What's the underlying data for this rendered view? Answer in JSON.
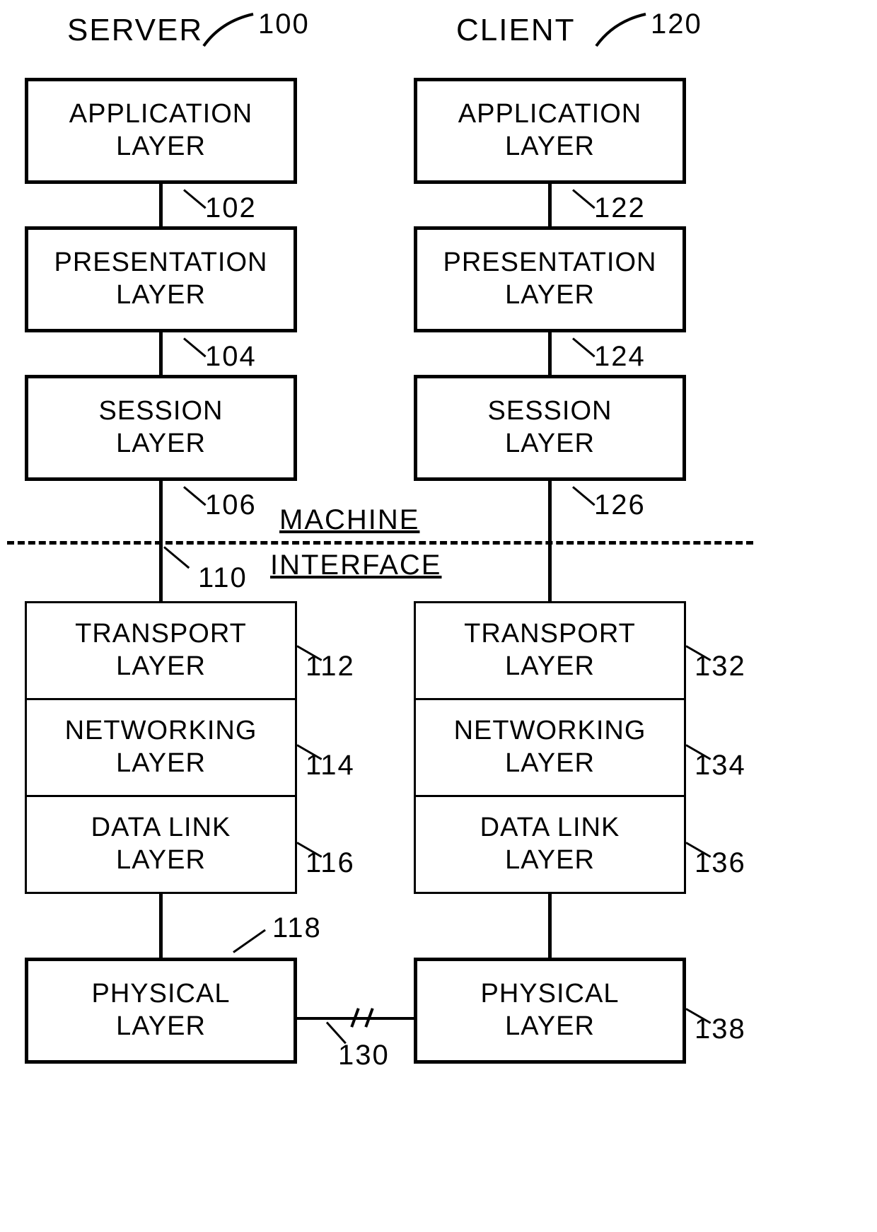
{
  "titles": {
    "server": "SERVER",
    "client": "CLIENT"
  },
  "refs": {
    "server": "100",
    "client": "120"
  },
  "divider_label_top": "MACHINE",
  "divider_label_bottom": "INTERFACE",
  "server": {
    "application": {
      "label": "APPLICATION\nLAYER",
      "ref": "102"
    },
    "presentation": {
      "label": "PRESENTATION\nLAYER",
      "ref": "104"
    },
    "session": {
      "label": "SESSION\nLAYER",
      "ref": "106"
    },
    "interface_ref": "110",
    "transport": {
      "label": "TRANSPORT\nLAYER",
      "ref": "112"
    },
    "networking": {
      "label": "NETWORKING\nLAYER",
      "ref": "114"
    },
    "datalink": {
      "label": "DATA LINK\nLAYER",
      "ref": "116"
    },
    "physical": {
      "label": "PHYSICAL\nLAYER",
      "ref": "118"
    }
  },
  "client": {
    "application": {
      "label": "APPLICATION\nLAYER",
      "ref": "122"
    },
    "presentation": {
      "label": "PRESENTATION\nLAYER",
      "ref": "124"
    },
    "session": {
      "label": "SESSION\nLAYER",
      "ref": "126"
    },
    "transport": {
      "label": "TRANSPORT\nLAYER",
      "ref": "132"
    },
    "networking": {
      "label": "NETWORKING\nLAYER",
      "ref": "134"
    },
    "datalink": {
      "label": "DATA LINK\nLAYER",
      "ref": "136"
    },
    "physical": {
      "label": "PHYSICAL\nLAYER",
      "ref": "138"
    }
  },
  "link_ref": "130"
}
